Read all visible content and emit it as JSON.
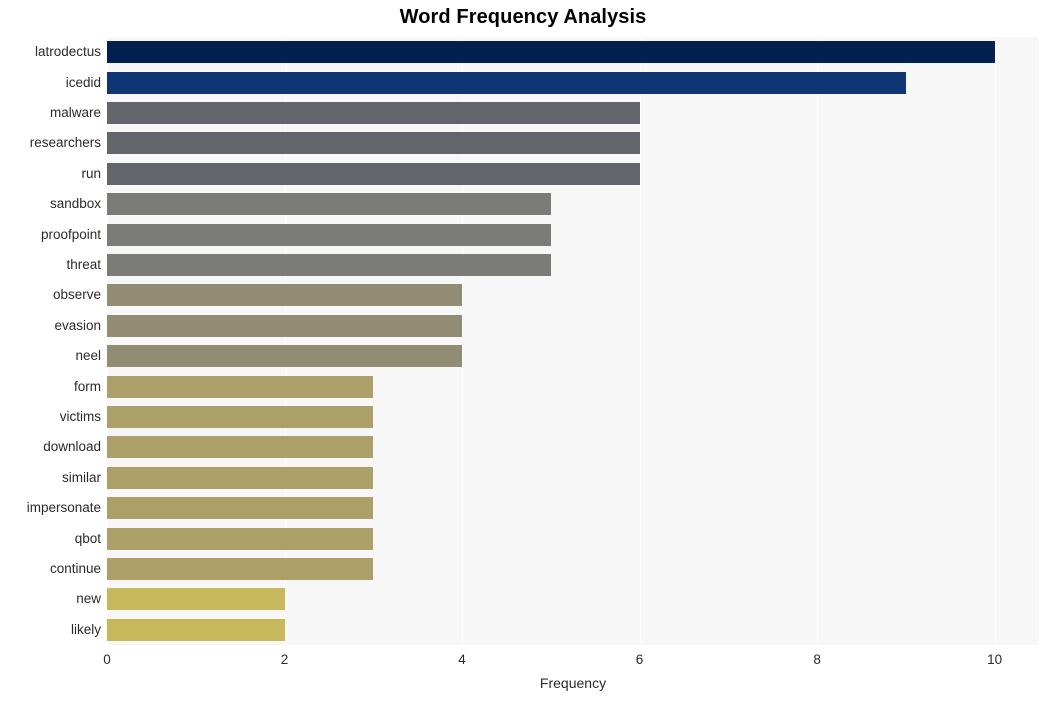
{
  "chart_data": {
    "type": "bar",
    "orientation": "horizontal",
    "title": "Word Frequency Analysis",
    "xlabel": "Frequency",
    "ylabel": "",
    "xlim": [
      0,
      10.5
    ],
    "xticks": [
      0,
      2,
      4,
      6,
      8,
      10
    ],
    "xtick_labels": [
      "0",
      "2",
      "4",
      "6",
      "8",
      "10"
    ],
    "grid": true,
    "grid_axis": "x",
    "legend": null,
    "plot_background": "#f7f7f7",
    "figure_background": "#ffffff",
    "categories": [
      "latrodectus",
      "icedid",
      "malware",
      "researchers",
      "run",
      "sandbox",
      "proofpoint",
      "threat",
      "observe",
      "evasion",
      "neel",
      "form",
      "victims",
      "download",
      "similar",
      "impersonate",
      "qbot",
      "continue",
      "new",
      "likely"
    ],
    "values": [
      10,
      9,
      6,
      6,
      6,
      5,
      5,
      5,
      4,
      4,
      4,
      3,
      3,
      3,
      3,
      3,
      3,
      3,
      2,
      2
    ],
    "bar_colors": [
      "#022050",
      "#0f3572",
      "#62656c",
      "#62656c",
      "#62656c",
      "#7b7b78",
      "#7b7b78",
      "#7b7b78",
      "#918c74",
      "#918c74",
      "#918c74",
      "#ad9f68",
      "#ad9f68",
      "#ad9f68",
      "#ad9f68",
      "#ad9f68",
      "#ad9f68",
      "#ad9f68",
      "#c8b85c",
      "#c8b85c"
    ]
  }
}
